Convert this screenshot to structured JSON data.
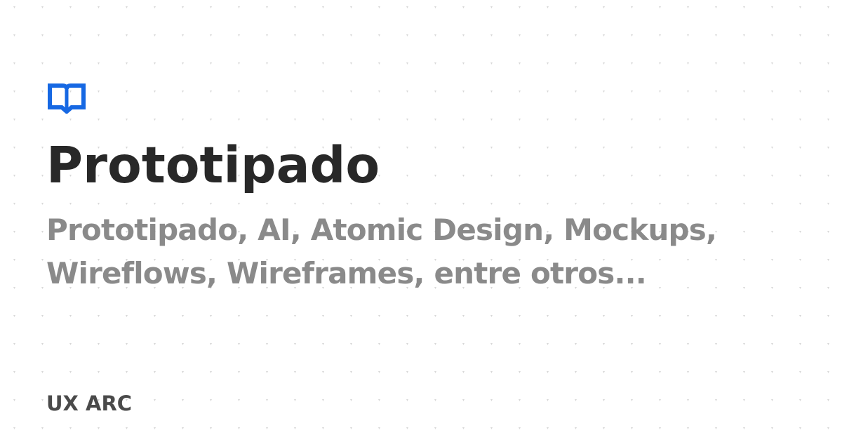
{
  "title": "Prototipado",
  "subtitle_lines": [
    "Prototipado, AI, Atomic Design, Mockups,",
    "Wireflows, Wireframes, entre otros..."
  ],
  "brand": "UX ARC",
  "icon": "book-open-icon",
  "colors": {
    "background": "#ffffff",
    "title": "#282828",
    "subtitle": "#8a8a8a",
    "brand": "#4a4a4a",
    "accent": "#1668e3",
    "pattern": "#d6d6d6"
  }
}
